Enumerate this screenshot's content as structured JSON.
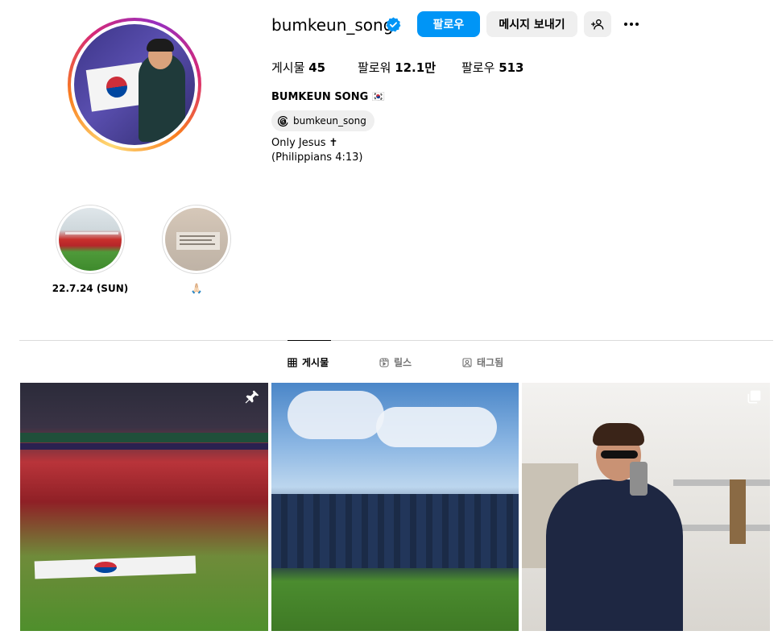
{
  "profile": {
    "username": "bumkeun_song",
    "verified": true,
    "full_name": "BUMKEUN SONG 🇰🇷",
    "threads_handle": "bumkeun_song",
    "bio_line1": "Only Jesus ✝",
    "bio_line2": "(Philippians 4:13)"
  },
  "actions": {
    "follow_label": "팔로우",
    "message_label": "메시지 보내기"
  },
  "stats": {
    "posts_label": "게시물",
    "posts_value": "45",
    "followers_label": "팔로워",
    "followers_value": "12.1만",
    "following_label": "팔로우",
    "following_value": "513"
  },
  "highlights": [
    {
      "label": "22.7.24 (SUN)"
    },
    {
      "label": "🙏🏻"
    }
  ],
  "tabs": [
    {
      "label": "게시물",
      "icon": "grid-icon",
      "active": true
    },
    {
      "label": "릴스",
      "icon": "reels-icon",
      "active": false
    },
    {
      "label": "태그됨",
      "icon": "tagged-icon",
      "active": false
    }
  ],
  "posts": [
    {
      "badge_icon": "pin-icon"
    },
    {
      "badge_icon": ""
    },
    {
      "badge_icon": "carousel-icon"
    }
  ],
  "colors": {
    "accent": "#0095f6",
    "button_gray": "#efefef",
    "divider": "#dbdbdb",
    "muted_text": "#737373"
  }
}
